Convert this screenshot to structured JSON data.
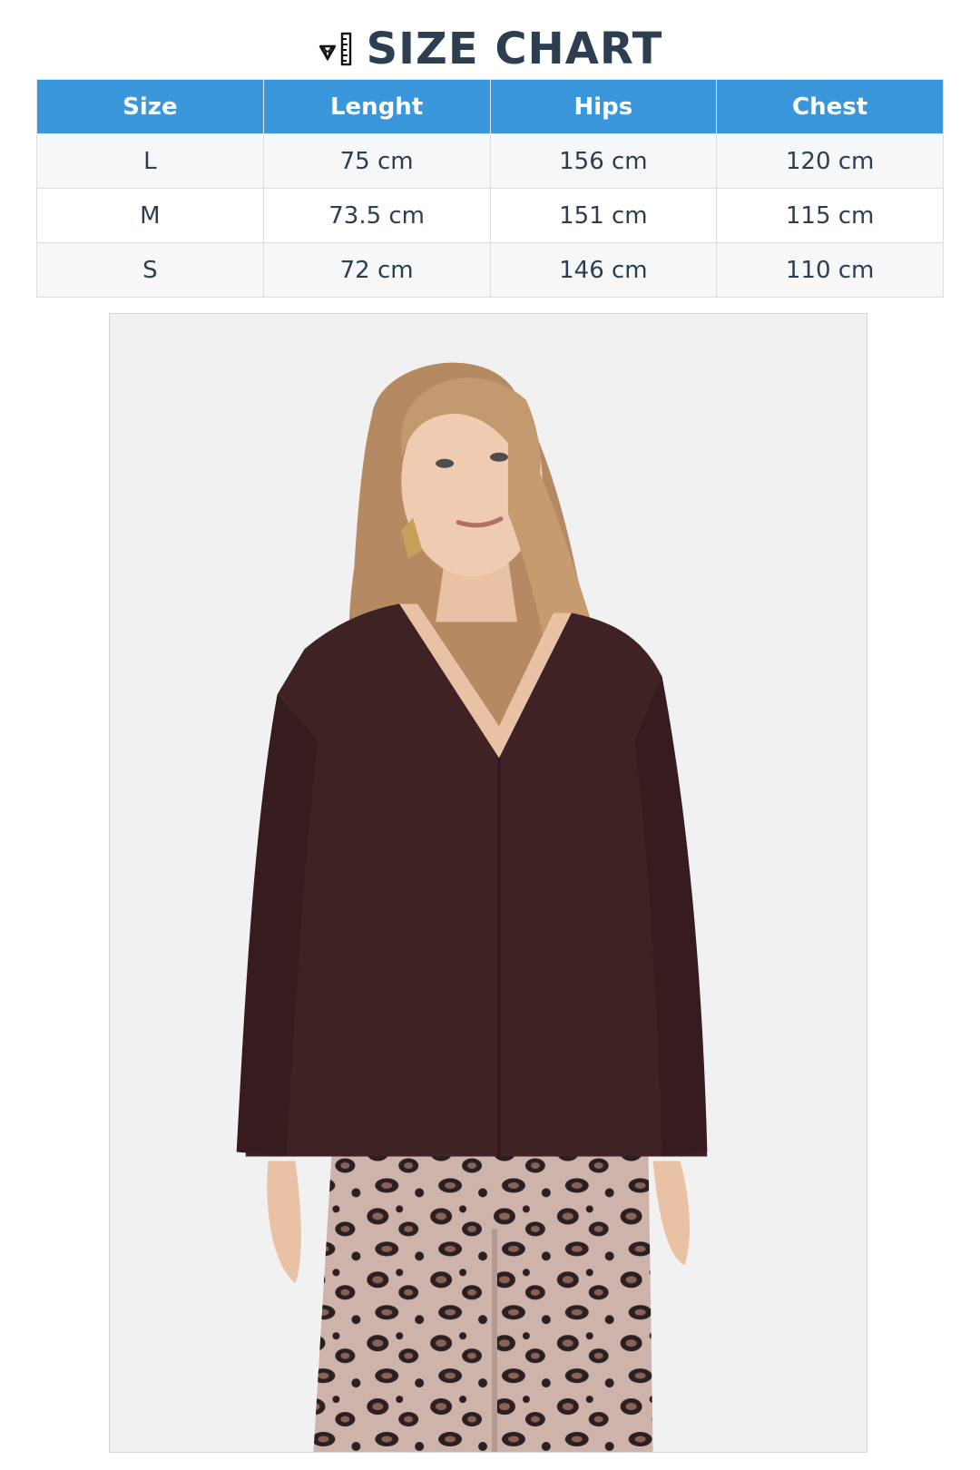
{
  "title": "SIZE CHART",
  "title_icon": "ruler-diamond-icon",
  "table": {
    "headers": [
      "Size",
      "Lenght",
      "Hips",
      "Chest"
    ],
    "rows": [
      [
        "L",
        "75 cm",
        "156 cm",
        "120 cm"
      ],
      [
        "M",
        "73.5 cm",
        "151 cm",
        "115 cm"
      ],
      [
        "S",
        "72 cm",
        "146 cm",
        "110 cm"
      ]
    ]
  },
  "colors": {
    "header_bg": "#3b97db",
    "header_text": "#ffffff",
    "title_text": "#2c3e50",
    "row_alt_bg": "#f5f7f8",
    "photo_bg": "#f1f1f1"
  }
}
